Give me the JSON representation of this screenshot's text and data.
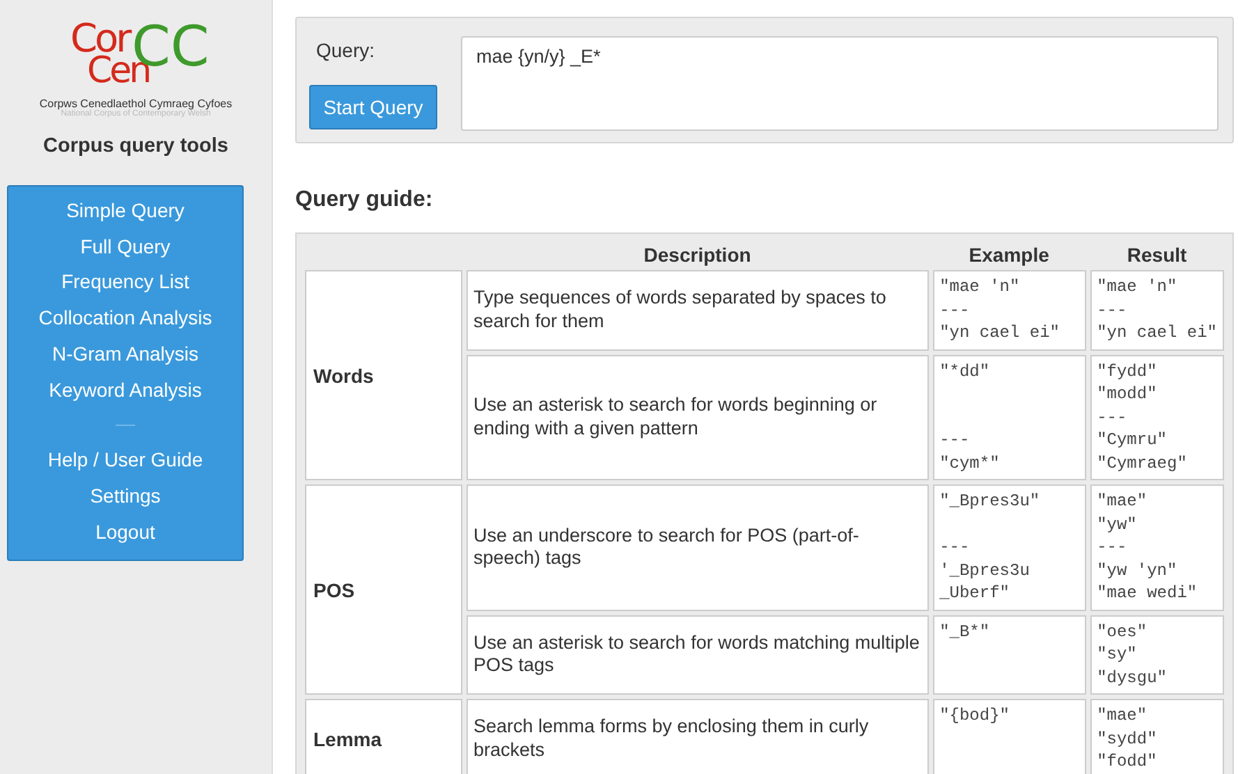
{
  "logo": {
    "line_1": "Cor",
    "line_2": "Cen",
    "mark": "CC",
    "name": "Corpws Cenedlaethol Cymraeg Cyfoes",
    "subtitle": "National Corpus of Contemporary Welsh"
  },
  "sidebar": {
    "title": "Corpus query tools",
    "items": [
      {
        "kind": "link",
        "label": "Simple Query"
      },
      {
        "kind": "link",
        "label": "Full Query"
      },
      {
        "kind": "link",
        "label": "Frequency List"
      },
      {
        "kind": "link",
        "label": "Collocation Analysis"
      },
      {
        "kind": "link",
        "label": "N-Gram Analysis"
      },
      {
        "kind": "link",
        "label": "Keyword Analysis"
      },
      {
        "kind": "separator"
      },
      {
        "kind": "link",
        "label": "Help / User Guide"
      },
      {
        "kind": "link",
        "label": "Settings"
      },
      {
        "kind": "link",
        "label": "Logout"
      }
    ]
  },
  "query": {
    "label": "Query:",
    "value": "mae {yn/y} _E*",
    "button": "Start Query"
  },
  "guide": {
    "heading": "Query guide:",
    "columns": [
      "Description",
      "Example",
      "Result"
    ],
    "groups": [
      {
        "category": "Words",
        "rows": [
          {
            "description": "Type sequences of words separated by spaces to search for them",
            "example": "\"mae 'n\"\n---\n\"yn cael ei\"",
            "result": "\"mae 'n\"\n---\n\"yn cael ei\""
          },
          {
            "description": "Use an asterisk to search for words beginning or ending with a given pattern",
            "example": "\"*dd\"\n\n\n---\n\"cym*\"",
            "result": "\"fydd\"\n\"modd\"\n---\n\"Cymru\"\n\"Cymraeg\""
          }
        ]
      },
      {
        "category": "POS",
        "rows": [
          {
            "description": "Use an underscore to search for POS (part-of-speech) tags",
            "example": "\"_Bpres3u\"\n\n---\n'_Bpres3u\n_Uberf\"",
            "result": "\"mae\"\n\"yw\"\n---\n\"yw 'yn\"\n\"mae wedi\""
          },
          {
            "description": "Use an asterisk to search for words matching multiple POS tags",
            "example": "\"_B*\"",
            "result": "\"oes\"\n\"sy\"\n\"dysgu\""
          }
        ]
      },
      {
        "category": "Lemma",
        "rows": [
          {
            "description": "Search lemma forms by enclosing them in curly brackets",
            "example": "\"{bod}\"",
            "result": "\"mae\"\n\"sydd\"\n\"fodd\""
          }
        ]
      }
    ]
  }
}
